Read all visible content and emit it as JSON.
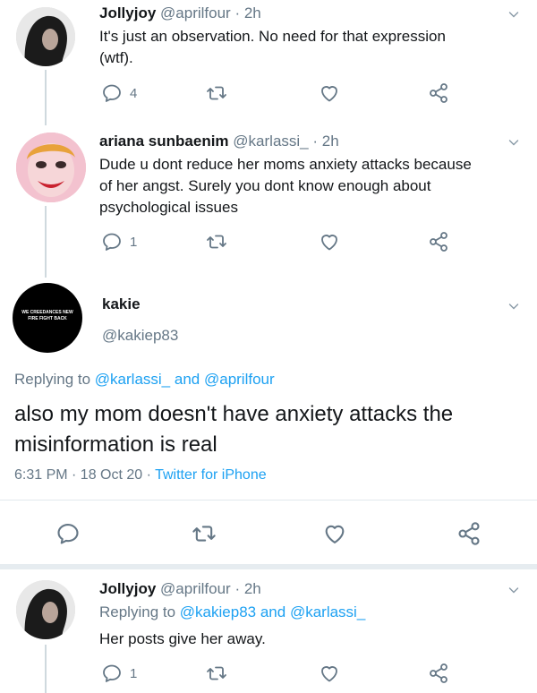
{
  "tweets": [
    {
      "name": "Jollyjoy",
      "handle": "@aprilfour",
      "time": "· 2h",
      "text_line1": "It's just an observation. No need for that expression",
      "text_line2": "(wtf).",
      "reply_count": "4"
    },
    {
      "name": "ariana sunbaenim",
      "handle": "@karlassi_",
      "time": "· 2h",
      "text_line1": "Dude u dont reduce her moms anxiety attacks because",
      "text_line2": "of her angst. Surely you dont know enough about",
      "text_line3": "psychological issues",
      "reply_count": "1"
    }
  ],
  "main_tweet": {
    "name": "kakie",
    "handle": "@kakiep83",
    "avatar_text": "WE CREEDANCES NEW FIRE FIGHT BACK",
    "replying_prefix": "Replying to",
    "replying_user1": "@karlassi_",
    "replying_and": "and",
    "replying_user2": "@aprilfour",
    "text_line1": "also my mom doesn't have anxiety attacks the",
    "text_line2": "misinformation is real",
    "timestamp": "6:31 PM · 18 Oct 20 ·",
    "source": "Twitter for iPhone"
  },
  "last_tweet": {
    "name": "Jollyjoy",
    "handle": "@aprilfour",
    "time": "· 2h",
    "replying_prefix": "Replying to",
    "replying_user1": "@kakiep83",
    "replying_and": "and",
    "replying_user2": "@karlassi_",
    "text": "Her posts give her away.",
    "reply_count": "1"
  },
  "icons": {
    "reply": "reply-icon",
    "retweet": "retweet-icon",
    "like": "heart-icon",
    "share": "share-icon",
    "more": "chevron-down-icon"
  },
  "colors": {
    "link": "#1da1f2",
    "muted": "#657786",
    "text": "#14171a"
  }
}
